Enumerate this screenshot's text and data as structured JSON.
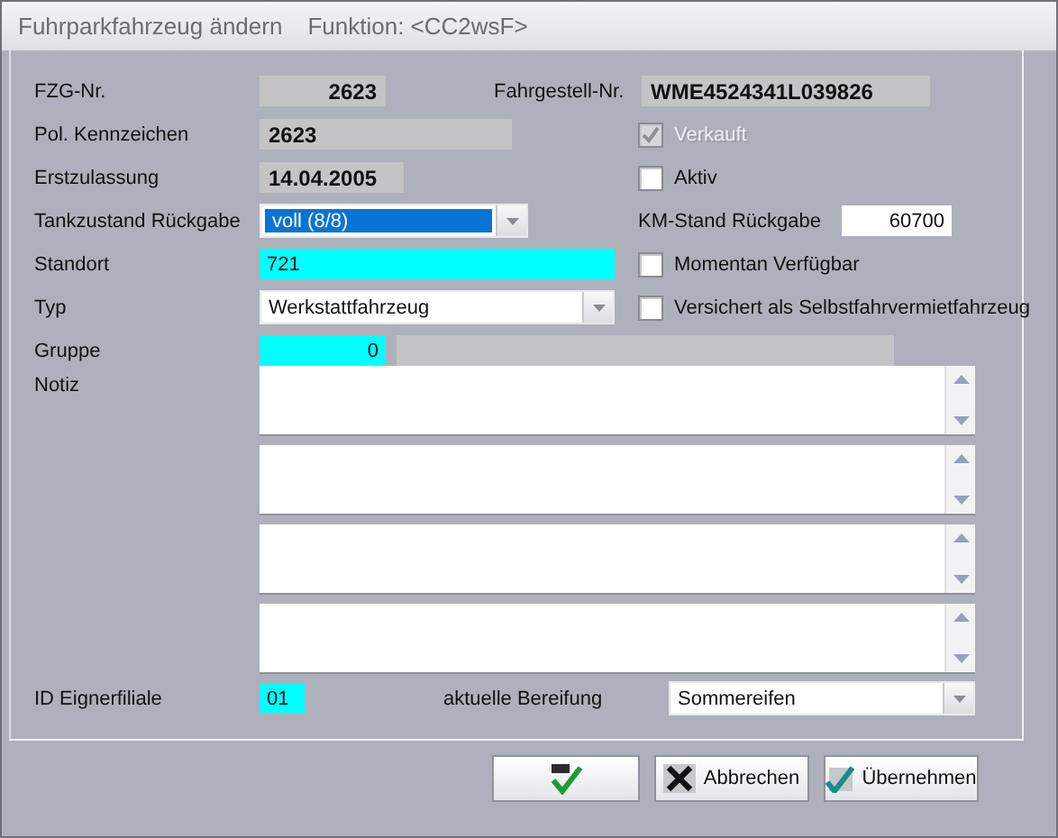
{
  "window": {
    "title": "Fuhrparkfahrzeug ändern",
    "function": "Funktion: <CC2wsF>"
  },
  "fzg_nr": {
    "label": "FZG-Nr.",
    "value": "2623"
  },
  "fahrgestell_nr": {
    "label": "Fahrgestell-Nr.",
    "value": "WME4524341L039826"
  },
  "kennzeichen": {
    "label": "Pol. Kennzeichen",
    "value": "2623"
  },
  "verkauft": {
    "label": "Verkauft",
    "checked": true,
    "disabled": true
  },
  "erstzulassung": {
    "label": "Erstzulassung",
    "value": "14.04.2005"
  },
  "aktiv": {
    "label": "Aktiv",
    "checked": false,
    "disabled": false
  },
  "tankzustand": {
    "label": "Tankzustand Rückgabe",
    "value": "voll (8/8)",
    "selected": true
  },
  "km_stand": {
    "label": "KM-Stand Rückgabe",
    "value": "60700"
  },
  "standort": {
    "label": "Standort",
    "value": "721"
  },
  "momentan_verfuegbar": {
    "label": "Momentan Verfügbar",
    "checked": false,
    "disabled": false
  },
  "typ": {
    "label": "Typ",
    "value": "Werkstattfahrzeug"
  },
  "versichert": {
    "label": "Versichert als Selbstfahrvermietfahrzeug",
    "checked": false,
    "disabled": false
  },
  "gruppe": {
    "label": "Gruppe",
    "value": "0"
  },
  "notiz": {
    "label": "Notiz",
    "fields": [
      {
        "kind": "textarea"
      },
      {
        "kind": "textarea"
      },
      {
        "kind": "textarea"
      },
      {
        "kind": "textarea"
      }
    ]
  },
  "id_eignerfiliale": {
    "label": "ID Eignerfiliale",
    "value": "01"
  },
  "bereifung": {
    "label": "aktuelle Bereifung",
    "value": "Sommereifen"
  },
  "buttons": [
    {
      "kind": "ok"
    },
    {
      "kind": "cancel",
      "label": "Abbrechen"
    },
    {
      "kind": "apply",
      "label": "Übernehmen"
    }
  ]
}
